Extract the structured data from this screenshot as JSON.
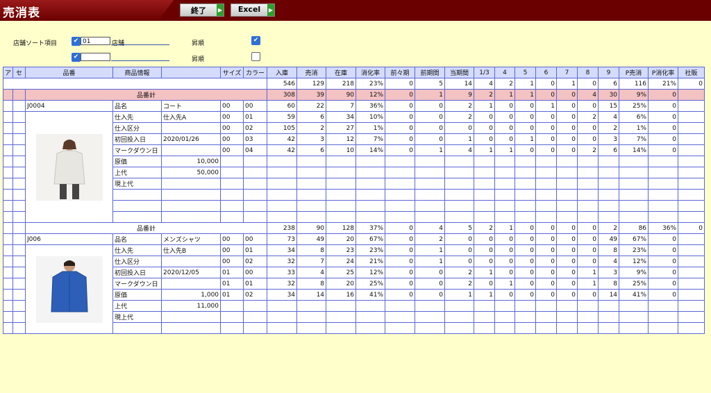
{
  "app": {
    "title": "売消表"
  },
  "toolbar": {
    "close_label": "終了",
    "excel_label": "Excel"
  },
  "filters": {
    "sort_label": "店舗ソート項目",
    "sort_code": "01",
    "sort_name": "店舗",
    "order1_label": "昇順",
    "order2_label": "昇順",
    "sort_code2": ""
  },
  "columns": [
    "ア",
    "セ",
    "品番",
    "商品情報",
    "",
    "サイズ",
    "カラー",
    "入庫",
    "売消",
    "在庫",
    "消化率",
    "前々期",
    "前期間",
    "当期間",
    "1/3",
    "4",
    "5",
    "6",
    "7",
    "8",
    "9",
    "P売消",
    "P消化率",
    "社販"
  ],
  "grand_total": [
    "546",
    "129",
    "218",
    "23%",
    "0",
    "5",
    "14",
    "4",
    "2",
    "1",
    "0",
    "1",
    "0",
    "6",
    "116",
    "21%",
    "0"
  ],
  "highlight_row": {
    "label": "品番計",
    "values": [
      "308",
      "39",
      "90",
      "12%",
      "0",
      "1",
      "9",
      "2",
      "1",
      "1",
      "0",
      "0",
      "4",
      "30",
      "9%",
      "0"
    ]
  },
  "products": [
    {
      "code": "J0004",
      "image_icon": "coat-photo",
      "info": [
        {
          "label": "品名",
          "value": "コート",
          "size": "00",
          "color": "00",
          "nums": [
            "60",
            "22",
            "7",
            "36%",
            "0",
            "0",
            "2",
            "1",
            "0",
            "0",
            "1",
            "0",
            "0",
            "15",
            "25%",
            "0"
          ]
        },
        {
          "label": "仕入先",
          "value": "仕入先A",
          "size": "00",
          "color": "01",
          "nums": [
            "59",
            "6",
            "34",
            "10%",
            "0",
            "0",
            "2",
            "0",
            "0",
            "0",
            "0",
            "0",
            "2",
            "4",
            "6%",
            "0"
          ]
        },
        {
          "label": "仕入区分",
          "value": "",
          "size": "00",
          "color": "02",
          "nums": [
            "105",
            "2",
            "27",
            "1%",
            "0",
            "0",
            "0",
            "0",
            "0",
            "0",
            "0",
            "0",
            "0",
            "2",
            "1%",
            "0"
          ]
        },
        {
          "label": "初回投入日",
          "value": "2020/01/26",
          "size": "00",
          "color": "03",
          "nums": [
            "42",
            "3",
            "12",
            "7%",
            "0",
            "0",
            "1",
            "0",
            "0",
            "1",
            "0",
            "0",
            "0",
            "3",
            "7%",
            "0"
          ]
        },
        {
          "label": "マークダウン日",
          "value": "",
          "size": "00",
          "color": "04",
          "nums": [
            "42",
            "6",
            "10",
            "14%",
            "0",
            "1",
            "4",
            "1",
            "1",
            "0",
            "0",
            "0",
            "2",
            "6",
            "14%",
            "0"
          ]
        },
        {
          "label": "原価",
          "value": "10,000",
          "size": "",
          "color": "",
          "nums": []
        },
        {
          "label": "上代",
          "value": "50,000",
          "size": "",
          "color": "",
          "nums": []
        },
        {
          "label": "現上代",
          "value": "",
          "size": "",
          "color": "",
          "nums": []
        }
      ]
    },
    {
      "code": "J006",
      "image_icon": "shirt-photo",
      "subtotal": {
        "label": "品番計",
        "values": [
          "238",
          "90",
          "128",
          "37%",
          "0",
          "4",
          "5",
          "2",
          "1",
          "0",
          "0",
          "0",
          "0",
          "2",
          "86",
          "36%",
          "0"
        ]
      },
      "info": [
        {
          "label": "品名",
          "value": "メンズシャツ",
          "size": "00",
          "color": "00",
          "nums": [
            "73",
            "49",
            "20",
            "67%",
            "0",
            "2",
            "0",
            "0",
            "0",
            "0",
            "0",
            "0",
            "0",
            "49",
            "67%",
            "0"
          ]
        },
        {
          "label": "仕入先",
          "value": "仕入先B",
          "size": "00",
          "color": "01",
          "nums": [
            "34",
            "8",
            "23",
            "23%",
            "0",
            "1",
            "0",
            "0",
            "0",
            "0",
            "0",
            "0",
            "0",
            "8",
            "23%",
            "0"
          ]
        },
        {
          "label": "仕入区分",
          "value": "",
          "size": "00",
          "color": "02",
          "nums": [
            "32",
            "7",
            "24",
            "21%",
            "0",
            "1",
            "0",
            "0",
            "0",
            "0",
            "0",
            "0",
            "0",
            "4",
            "12%",
            "0"
          ]
        },
        {
          "label": "初回投入日",
          "value": "2020/12/05",
          "size": "01",
          "color": "00",
          "nums": [
            "33",
            "4",
            "25",
            "12%",
            "0",
            "0",
            "2",
            "1",
            "0",
            "0",
            "0",
            "0",
            "1",
            "3",
            "9%",
            "0"
          ]
        },
        {
          "label": "マークダウン日",
          "value": "",
          "size": "01",
          "color": "01",
          "nums": [
            "32",
            "8",
            "20",
            "25%",
            "0",
            "0",
            "2",
            "0",
            "1",
            "0",
            "0",
            "0",
            "1",
            "8",
            "25%",
            "0"
          ]
        },
        {
          "label": "原価",
          "value": "1,000",
          "size": "01",
          "color": "02",
          "nums": [
            "34",
            "14",
            "16",
            "41%",
            "0",
            "0",
            "1",
            "1",
            "0",
            "0",
            "0",
            "0",
            "0",
            "14",
            "41%",
            "0"
          ]
        },
        {
          "label": "上代",
          "value": "11,000",
          "size": "",
          "color": "",
          "nums": []
        },
        {
          "label": "現上代",
          "value": "",
          "size": "",
          "color": "",
          "nums": []
        }
      ]
    }
  ]
}
